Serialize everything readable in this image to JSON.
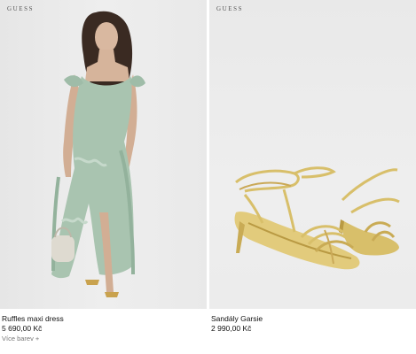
{
  "products": [
    {
      "brand": "GUESS",
      "title": "Ruffles maxi dress",
      "price": "5 690,00 Kč",
      "more_colors": "Více barev +",
      "image_alt": "Ruffles maxi dress",
      "dress_color": "#a9c4b0"
    },
    {
      "brand": "GUESS",
      "title": "Sandály Garsie",
      "price": "2 990,00 Kč",
      "image_alt": "Sandály Garsie",
      "sandal_color": "#d8bf6a"
    }
  ]
}
